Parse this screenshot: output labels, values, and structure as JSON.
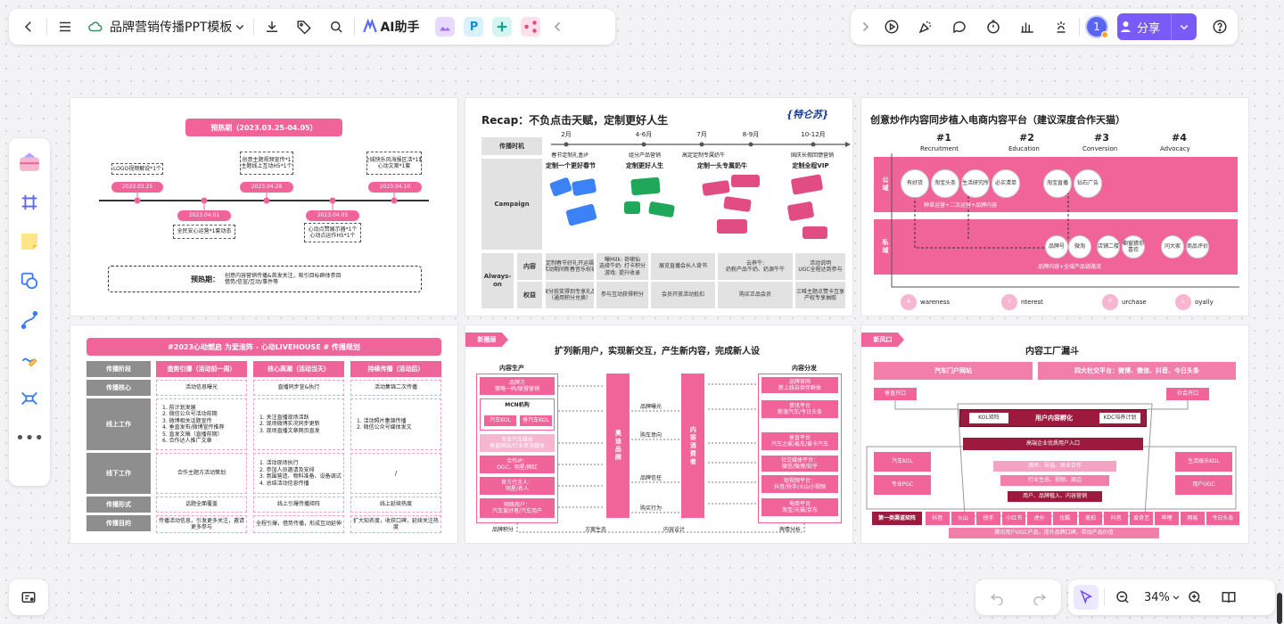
{
  "toolbar": {
    "doc_title": "品牌营销传播PPT模板",
    "ai_label": "AI助手",
    "avatar_number": "1",
    "share_label": "分享"
  },
  "zoom": {
    "level": "34%"
  },
  "colors": {
    "accent": "#f0649a",
    "share": "#7a5af8"
  },
  "slide1": {
    "title": "预热期（2023.03.25-04.05）",
    "top_notes": [
      "LOGO视频解说*1个",
      "创意主题视频宣传*1\n主题线上互动H5*1个",
      "全城快乐风海报区活*1套\n心动文案*1套"
    ],
    "top_dates": [
      "2023.03.25",
      "2023.04.28",
      "2023.04.10"
    ],
    "bottom_dates": [
      "2023.04.01",
      "2023.04.05"
    ],
    "bottom_notes": [
      "全民安心运营*1套动态",
      "心动点赞展示器*1个\n心动点运作H5*1个"
    ],
    "footer_label": "预热期：",
    "footer_text": "创意内容营销传播&首发关注，吸引目标群体参目\n借势/信宣/互动/事件等"
  },
  "slide2": {
    "title": "Recap：不负点击天赋，定制更好人生",
    "logo_text": "{特仑苏}",
    "row_label_time": "传播时机",
    "row_label_campaign": "Campaign",
    "row_label_always": "Always-on",
    "sub_content": "内容",
    "sub_rights": "权益",
    "months": [
      "2月",
      "4-6月",
      "7月",
      "8-9月",
      "10-12月"
    ],
    "month_notes": [
      "春节定制礼盒IP",
      "组分产品营销",
      "高定定制专属奶牛",
      "高定发布会事件营销",
      "国庆长假回馈营销"
    ],
    "month_heads": [
      "定制一个更好春节",
      "定制更好人生",
      "定制一头专属奶牛",
      "定制全程VIP"
    ],
    "content_cells": [
      "定制春节好礼开运福\n活动期间新春音乐祝福",
      "曝Milk: 奇啸仙\n选择牛奶: 打卡积分\n游戏: 提升收录",
      "展览直播会长人背书",
      "云养牛:\n奶粉产品牛奶、奶源牛牛",
      "活动说明\nUGC全程达到参与"
    ],
    "rights_cells": [
      "保分获奖得到专享礼品\n（通用积分兑换）",
      "参与互动获得积分",
      "会员开放活动抵扣",
      "购买正品会员",
      "三唯主题点赞卡互享\n产权专享抽取"
    ]
  },
  "slide3": {
    "title": "创意炒作内容同步植入电商内容平台（建议深度合作天猫）",
    "stages": [
      {
        "num": "#1",
        "name": "Recruitment"
      },
      {
        "num": "#2",
        "name": "Education"
      },
      {
        "num": "#3",
        "name": "Conversion"
      },
      {
        "num": "#4",
        "name": "Advocacy"
      }
    ],
    "band_public": "公域",
    "band_private": "私域",
    "public_circles": [
      "有好货",
      "淘宝头条",
      "生活研究所",
      "必买清单",
      "淘宝直播",
      "钻石广告"
    ],
    "public_caption": "种草运营+二次运营+品牌内容",
    "private_circles": [
      "品牌号",
      "微淘",
      "店铺二楼",
      "橱窗猜你喜欢",
      "问大家",
      "商品评价"
    ],
    "private_caption": "品牌内容+全域产品链路流",
    "aipl": [
      {
        "letter": "A",
        "word": "wareness"
      },
      {
        "letter": "I",
        "word": "nterest"
      },
      {
        "letter": "P",
        "word": "urchase"
      },
      {
        "letter": "L",
        "word": "oyally"
      }
    ]
  },
  "slide4": {
    "title": "#2023心动燃启 为爱淮阵 - 心动LIVEHOUSE # 传播规划",
    "row_labels": [
      "传播阶段",
      "传播核心",
      "线上工作",
      "线下工作",
      "传播形式",
      "传播目的"
    ],
    "col_heads": [
      "造势引爆（活动前一周）",
      "核心高潮（活动当天）",
      "持续传播（活动后）"
    ],
    "core": [
      "活动信息曝光",
      "直播同步宣&执行",
      "活动集锦二次传播"
    ],
    "online": [
      "1. 前计划发展\n2. 微信公众号活动前期\n3. 微博相关话题宣传\n4. 垂直发布/微博宣传推荐\n5. 直发文稿（直播前期）\n6. 合作达人推广文章",
      "1. 关注直播现场活跃\n2. 现场微博实况同步更新\n3. 现场直播文章网页直发",
      "1. 活动照片集锦传播\n2. 微信公众号媒体发文"
    ],
    "offline": [
      "合作主题方活动策划",
      "1. 活动现场执行\n2. 参加人员邀请及安排\n3. 氛围营造、物料准备、设备调试\n4. 总结活动信息传播",
      "/"
    ],
    "form": [
      "话题全面覆盖",
      "线上引爆传播矩阵",
      "线上延续热度"
    ],
    "purpose": [
      "传播活动信息，引发更多关注，邀请更多参与",
      "全程引爆，借势传播，形成互动延伸",
      "扩大知名度，收获口碑，延续关注热度"
    ]
  },
  "slide5": {
    "tag": "新圈层",
    "title": "扩列新用户，实现新交互，产生新内容，完成新人设",
    "left_head": "内容生产",
    "right_head": "内容分发",
    "left_items": [
      "品牌方\n策略一码/联营营销",
      "MCN机构",
      "专业汽车媒体\n垂直网站/行业资讯媒体",
      "合作IP：\nOGC、明星/网红",
      "官方代言人：\n明星/名人",
      "网络用户：\n汽车爱好者/汽车用户"
    ],
    "mcn_children": [
      "汽车KOL",
      "垂汽车KOL"
    ],
    "center_left": "奥迪品牌",
    "center_right": "内容消费者",
    "right_items": [
      "品牌官网\n新上线自供伴群体",
      "资讯平台\n新浪汽车/今日头条",
      "垂直平台\n汽车之家/易车/爱卡汽车",
      "社交媒体平台：\n微信/微博/知乎",
      "短视频平台：\n抖音/快手/火山小视频",
      "电商平台\n淘宝/天猫/京东"
    ],
    "mid_labels": [
      "品牌曝光",
      "购车意向",
      "品牌信任",
      "购买行为"
    ],
    "footer": [
      "品牌积分",
      "方案生态",
      "内容设计",
      "舆情分析"
    ]
  },
  "slide6": {
    "tag": "新风口",
    "title": "内容工厂漏斗",
    "top_left": "汽车门户网站",
    "top_right": "四大社交平台：微博、微信、抖音、今日头条",
    "side_left": "垂直开口",
    "side_right": "社会开口",
    "kol_left": "KOL矩阵",
    "center": "用户内容孵化",
    "kdc_right": "KDC培养计划",
    "bar2": "高端企业优质用户入口",
    "left_boxes": [
      "汽车KOL",
      "专业PGC"
    ],
    "right_boxes": [
      "生活娱乐KOL",
      "用户UGC"
    ],
    "funnel_rows": [
      "测评、导选、异业合作",
      "行业生态、视频、周边",
      "用户、品牌植入、内容营销"
    ],
    "bottom_label": "第一类渠道矩阵",
    "channels": [
      "抖音",
      "火山",
      "快手",
      "小红书",
      "虎扑",
      "优酷",
      "美拍",
      "抖音",
      "爱奇艺",
      "哔哩",
      "网易",
      "今日头条"
    ],
    "footer": "腾讯用户UGC产品，提升品牌口碑，带动产品价值"
  }
}
